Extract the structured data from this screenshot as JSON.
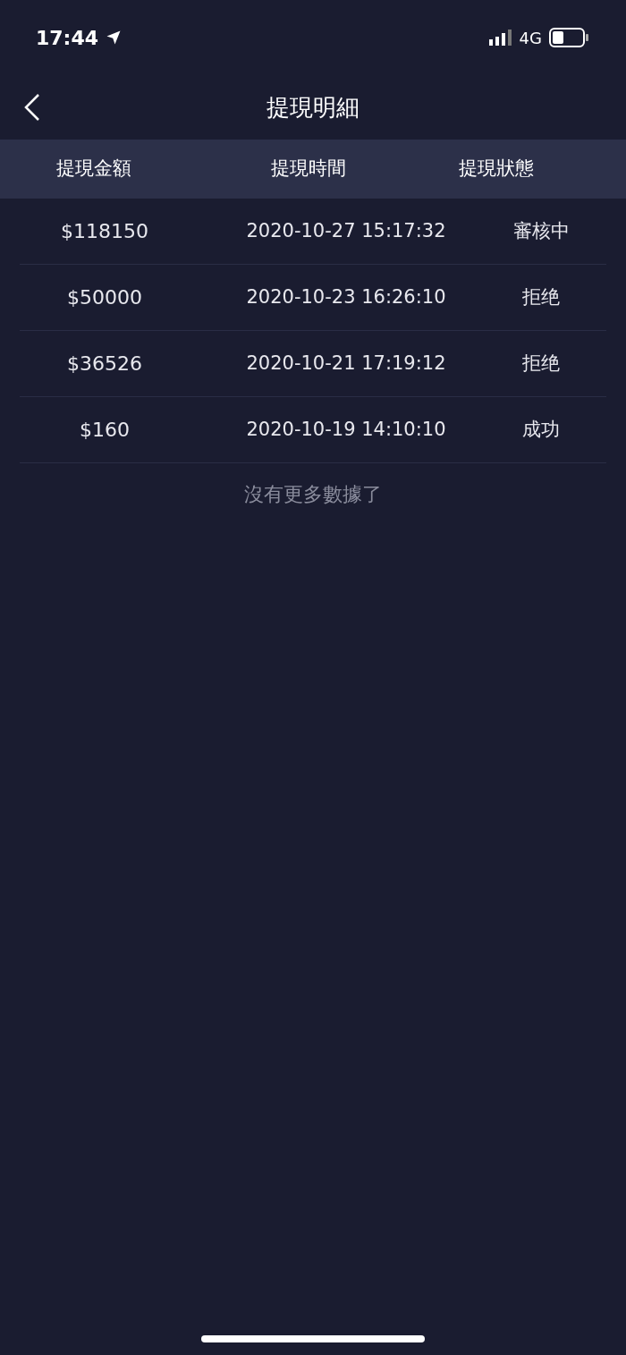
{
  "status_bar": {
    "time": "17:44",
    "network": "4G"
  },
  "nav": {
    "title": "提現明細"
  },
  "table": {
    "columns": [
      "提現金額",
      "提現時間",
      "提現狀態"
    ],
    "rows": [
      {
        "amount": "$118150",
        "time": "2020-10-27 15:17:32",
        "status": "審核中"
      },
      {
        "amount": "$50000",
        "time": "2020-10-23 16:26:10",
        "status": "拒绝"
      },
      {
        "amount": "$36526",
        "time": "2020-10-21 17:19:12",
        "status": "拒绝"
      },
      {
        "amount": "$160",
        "time": "2020-10-19 14:10:10",
        "status": "成功"
      }
    ]
  },
  "footer_note": "沒有更多數據了"
}
